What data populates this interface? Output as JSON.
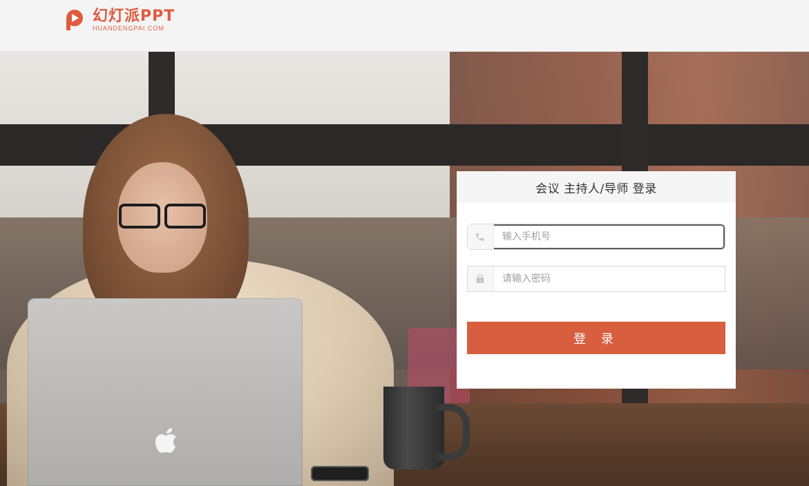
{
  "header": {
    "brand_cn": "幻灯派PPT",
    "brand_en": "HUANDENGPAI.COM",
    "brand_color": "#e05a3e"
  },
  "login_card": {
    "title": "会议 主持人/导师 登录",
    "phone": {
      "icon": "phone-icon",
      "value": "",
      "placeholder": "输入手机号"
    },
    "password": {
      "icon": "lock-icon",
      "value": "",
      "placeholder": "请输入密码"
    },
    "login_label": "登 录",
    "accent_color": "#d95d3f"
  }
}
